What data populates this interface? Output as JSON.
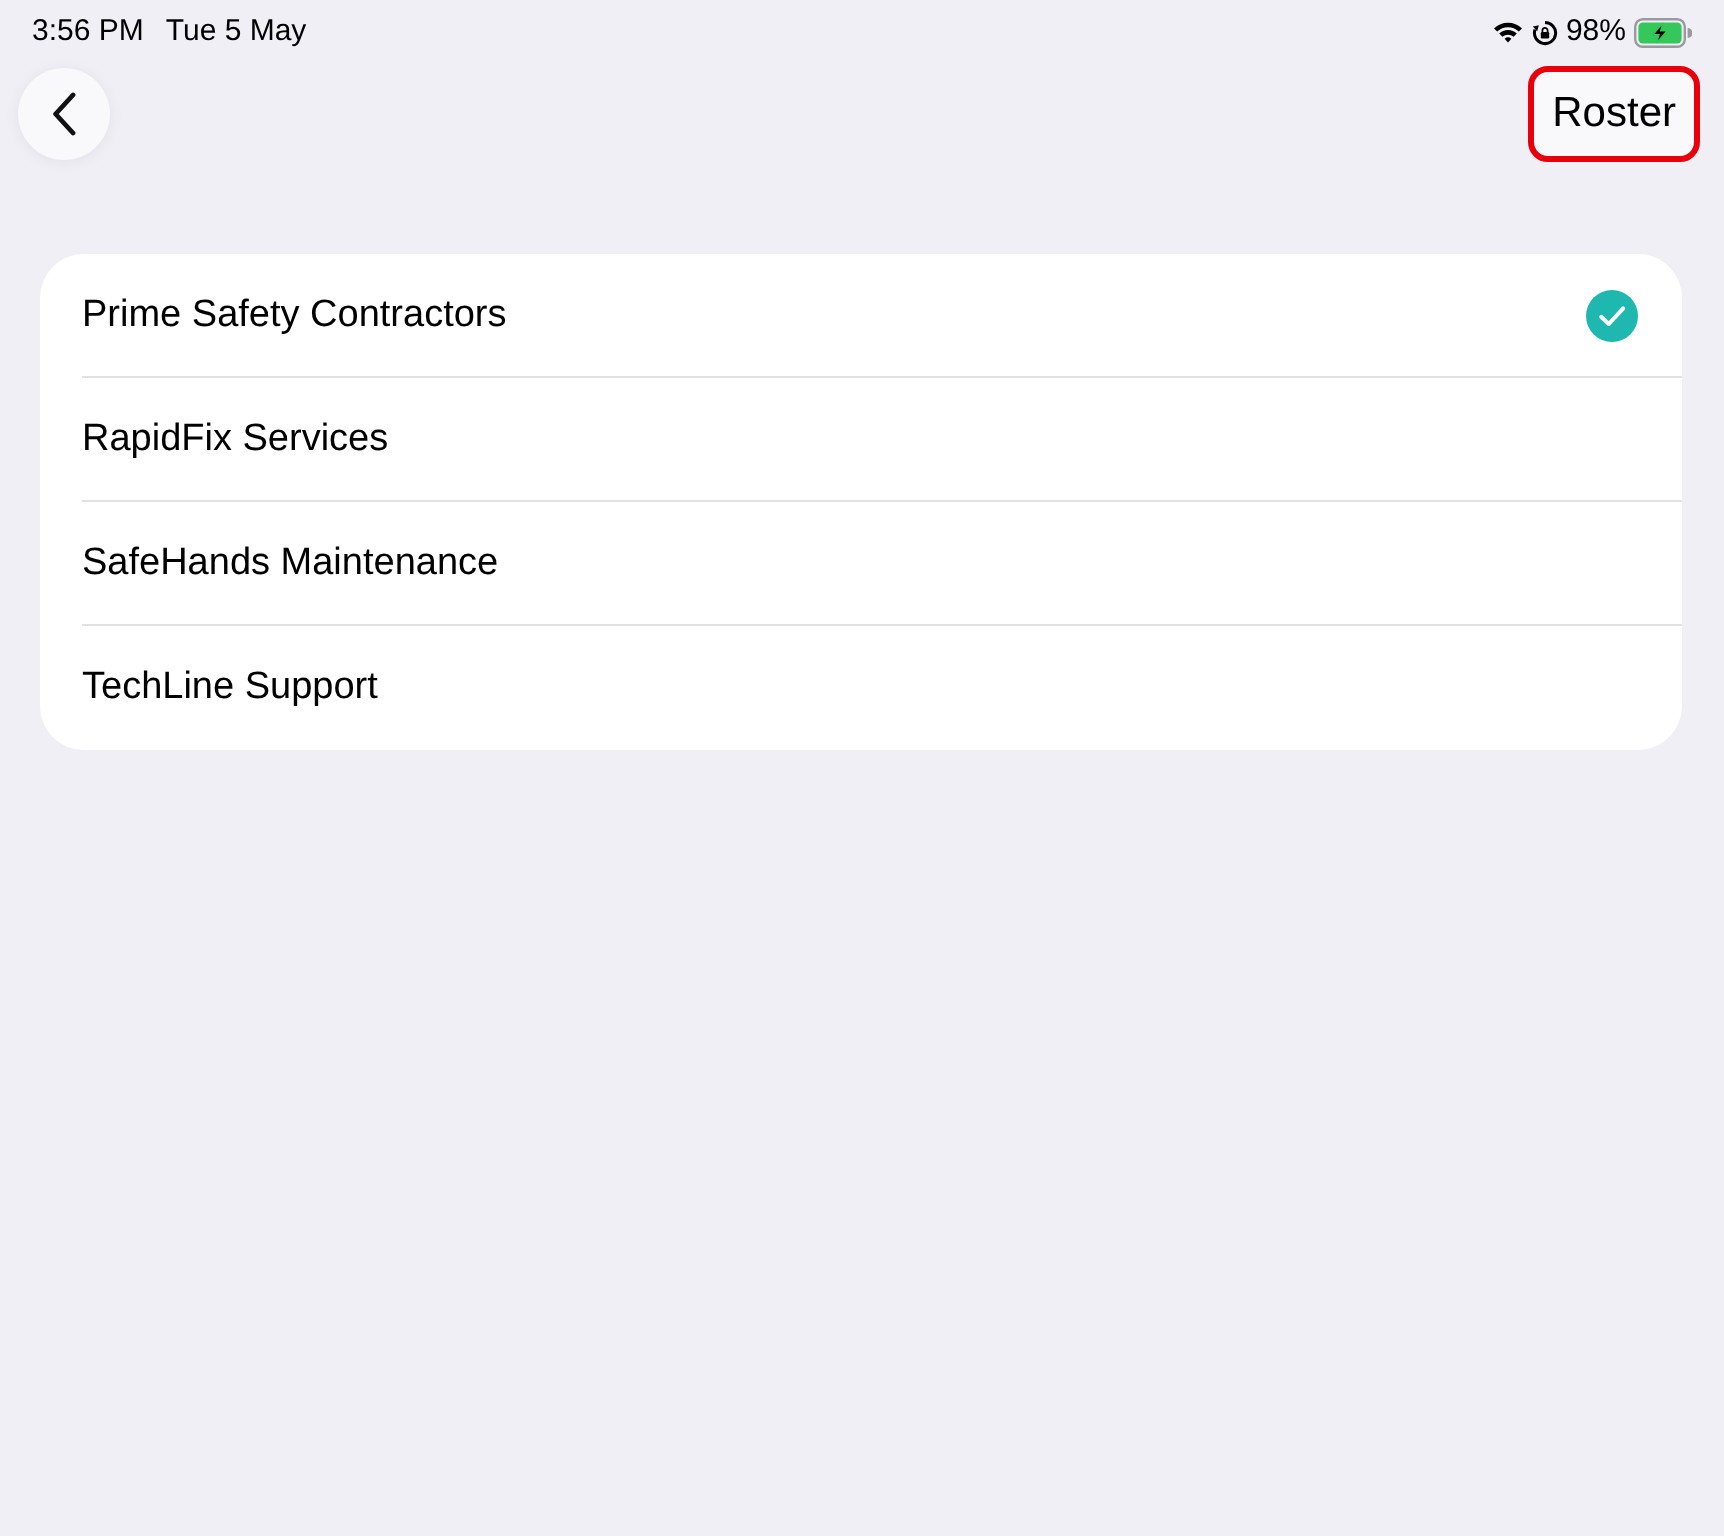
{
  "status_bar": {
    "time": "3:56 PM",
    "date": "Tue 5 May",
    "battery": "98%",
    "charging": true
  },
  "nav_bar": {
    "roster_button": {
      "label": "Roster",
      "highlighted": true
    }
  },
  "list": {
    "items": [
      {
        "label": "Prime Safety Contractors",
        "selected": true
      },
      {
        "label": "RapidFix Services",
        "selected": false
      },
      {
        "label": "SafeHands Maintenance",
        "selected": false
      },
      {
        "label": "TechLine Support",
        "selected": false
      }
    ]
  }
}
